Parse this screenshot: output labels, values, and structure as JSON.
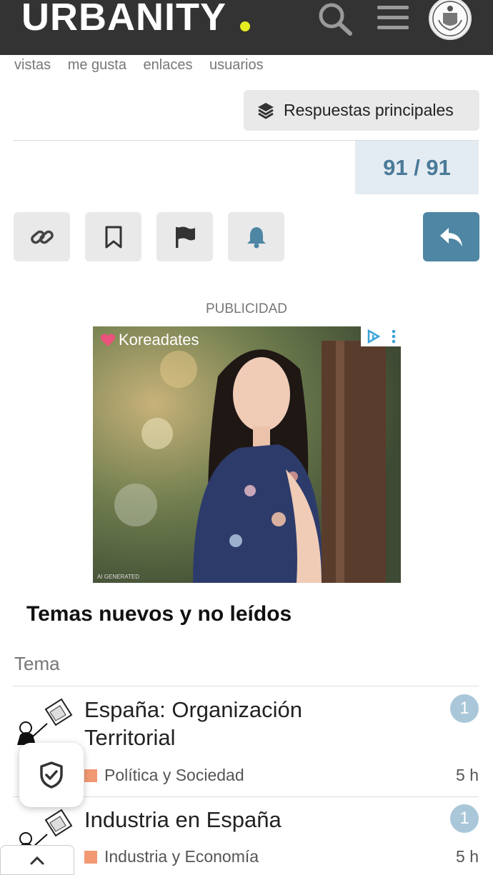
{
  "header": {
    "logo_text": "URBANITY",
    "logo_dot_color": "#e5ec22",
    "bg_color": "#333333"
  },
  "icons": {
    "search": "search-icon",
    "menu": "hamburger-menu-icon",
    "avatar": "user-avatar"
  },
  "stats": {
    "labels": [
      "vistas",
      "me gusta",
      "enlaces",
      "usuarios"
    ]
  },
  "top_replies_label": "Respuestas principales",
  "progress": {
    "current": 91,
    "total": 91,
    "text": "91 / 91"
  },
  "actions": [
    "link-icon",
    "bookmark-icon",
    "flag-icon",
    "bell-icon",
    "reply-icon"
  ],
  "ad": {
    "label": "PUBLICIDAD",
    "brand": "Koreadates",
    "footer": "AI GENERATED"
  },
  "section": {
    "title": "Temas nuevos y no leídos",
    "column_header": "Tema"
  },
  "topics": [
    {
      "title": "España: Organización Territorial",
      "category": "Política y Sociedad",
      "category_color": "#f29974",
      "unread": "1",
      "time": "5 h"
    },
    {
      "title": "Industria en España",
      "category": "Industria y Economía",
      "category_color": "#f29974",
      "unread": "1",
      "time": "5 h"
    }
  ]
}
